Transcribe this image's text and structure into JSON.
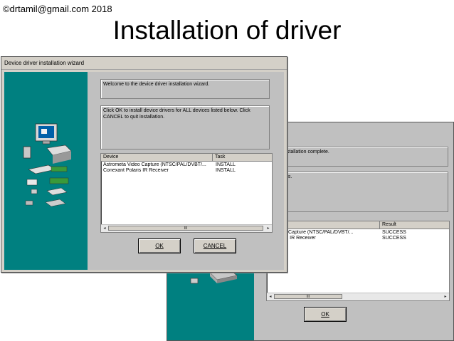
{
  "slide": {
    "copyright": "©drtamil@gmail.com 2018",
    "title": "Installation of driver"
  },
  "wizard_front": {
    "title": "Device driver installation wizard",
    "welcome": "Welcome to the device driver installation wizard.",
    "instructions": "Click OK to install device drivers for ALL devices listed below. Click CANCEL to quit installation.",
    "columns": [
      "Device",
      "Task"
    ],
    "rows": [
      {
        "device": "Astrometa Video Capture (NTSC/PAL/DVBT/...",
        "task": "INSTALL"
      },
      {
        "device": "Conexant Polaris IR Receiver",
        "task": "INSTALL"
      }
    ],
    "scroll_thumb": "III",
    "ok_label": "OK",
    "cancel_label": "CANCEL"
  },
  "wizard_back": {
    "status": "driver installation complete.",
    "results_label": "on results.",
    "columns": [
      "",
      "Result"
    ],
    "rows": [
      {
        "device": "ita Video Capture (NTSC/PAL/DVBT/...",
        "result": "SUCCESS"
      },
      {
        "device": "nt Polaris IR Receiver",
        "result": "SUCCESS"
      }
    ],
    "scroll_thumb": "III",
    "ok_label": "OK"
  },
  "colors": {
    "teal": "#008080",
    "dialog": "#d4d0c8"
  }
}
